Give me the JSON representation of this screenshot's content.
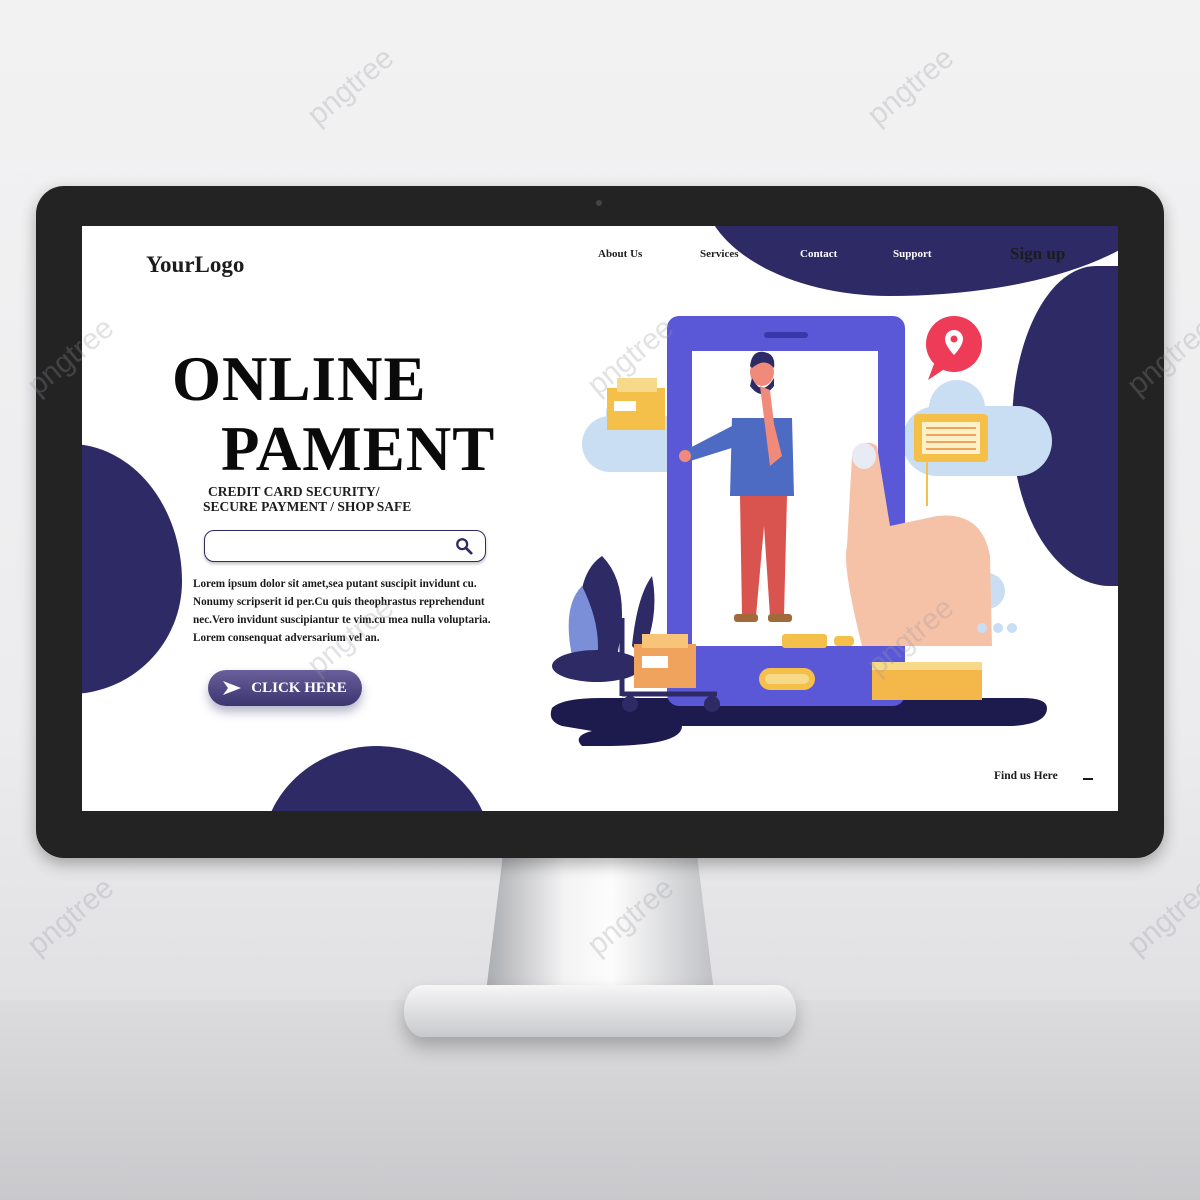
{
  "brand": {
    "logo": "YourLogo"
  },
  "nav": {
    "items": [
      {
        "label": "About Us"
      },
      {
        "label": "Services"
      },
      {
        "label": "Contact"
      },
      {
        "label": "Support"
      }
    ],
    "signup": "Sign up"
  },
  "hero": {
    "title_line1": "ONLINE",
    "title_line2": "PAMENT",
    "subtitle_line1": "CREDIT CARD SECURITY/",
    "subtitle_line2": "SECURE PAYMENT / SHOP SAFE",
    "body": [
      "Lorem ipsum dolor sit amet,sea putant suscipit invidunt cu.",
      "Nonumy scripserit id per.Cu quis theophrastus reprehendunt",
      "nec.Vero invidunt suscipiantur te vim.cu mea nulla voluptaria.",
      "Lorem consenquat adversarium vel an."
    ],
    "cta": "CLICK HERE"
  },
  "search": {
    "placeholder": "",
    "value": ""
  },
  "footer": {
    "find_us": "Find us Here"
  },
  "watermark": "pngtree",
  "colors": {
    "navy": "#2d2a66",
    "phone_purple": "#5b58d8",
    "box_orange": "#f0a35c",
    "pin_red": "#ee3b57",
    "card_yellow": "#f4c04a",
    "cloud_blue": "#c9def3"
  },
  "icons": [
    "search-icon",
    "arrow-icon",
    "location-pin-icon",
    "chat-card-icon",
    "package-icon",
    "hand-pointer-icon"
  ]
}
